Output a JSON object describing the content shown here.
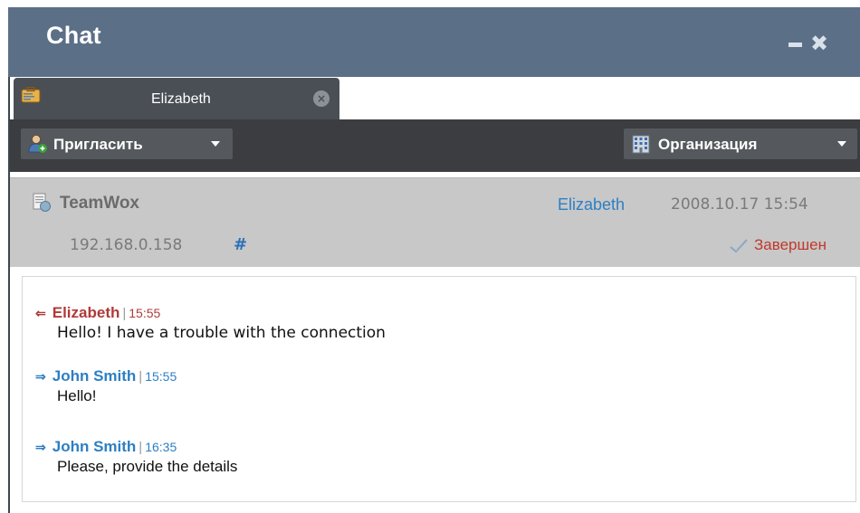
{
  "window": {
    "title": "Chat",
    "minimize_icon": "minimize-icon",
    "close_icon": "close-icon"
  },
  "tab": {
    "label": "Elizabeth",
    "icon": "briefcase-icon",
    "close_icon": "tab-close-icon"
  },
  "toolbar": {
    "invite_label": "Пригласить",
    "invite_icon": "add-user-icon",
    "org_label": "Организация",
    "org_icon": "building-icon"
  },
  "info": {
    "company": "TeamWox",
    "company_icon": "document-icon",
    "ip": "192.168.0.158",
    "hash": "#",
    "user": "Elizabeth",
    "datetime": "2008.10.17 15:54",
    "status": "Завершен",
    "status_icon": "checkmark-icon"
  },
  "messages": [
    {
      "direction": "incoming",
      "author": "Elizabeth",
      "time": "15:55",
      "text": "Hello! I have a trouble with the connection",
      "color": "#b03a3a"
    },
    {
      "direction": "outgoing",
      "author": "John Smith",
      "time": "15:55",
      "text": "Hello!",
      "color": "#2c7fc4"
    },
    {
      "direction": "outgoing",
      "author": "John Smith",
      "time": "16:35",
      "text": "Please, provide the details",
      "color": "#2c7fc4"
    }
  ],
  "colors": {
    "titlebar": "#5b6f87",
    "toolbar": "#3b3d40",
    "info_panel": "#c8c8c8",
    "incoming": "#b03a3a",
    "outgoing": "#2c7fc4",
    "status": "#c0392b"
  }
}
